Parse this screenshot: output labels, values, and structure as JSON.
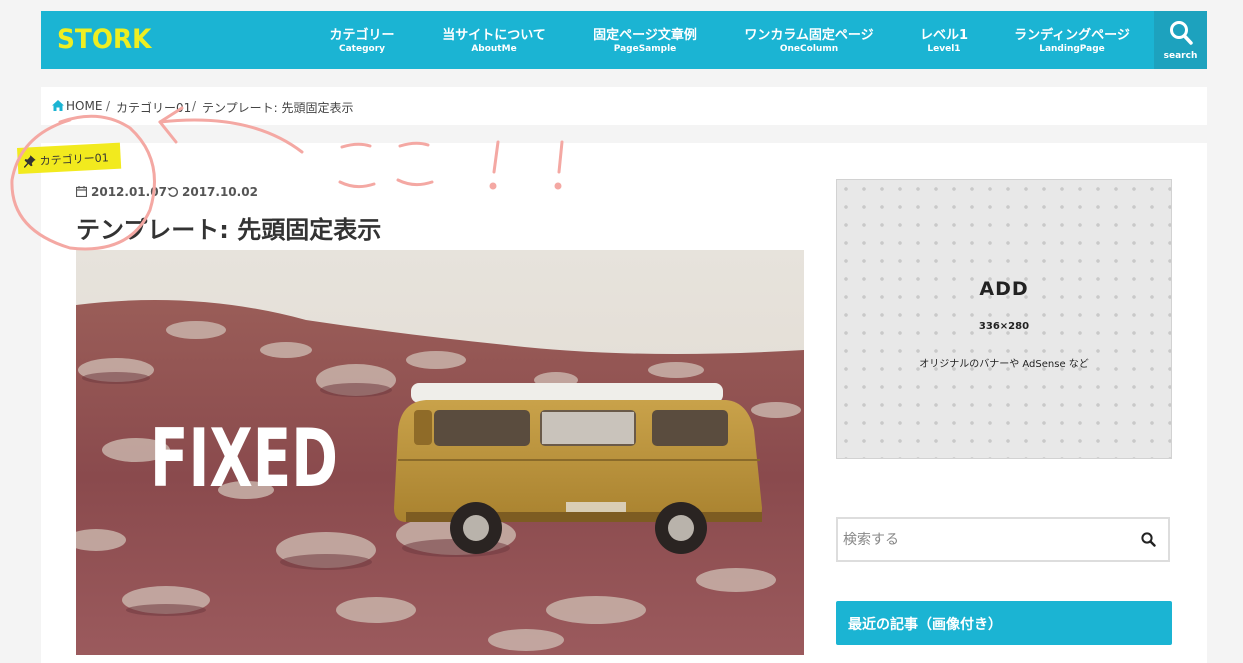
{
  "header": {
    "logo": "STORK",
    "nav": [
      {
        "ja": "カテゴリー",
        "en": "Category"
      },
      {
        "ja": "当サイトについて",
        "en": "AboutMe"
      },
      {
        "ja": "固定ページ文章例",
        "en": "PageSample"
      },
      {
        "ja": "ワンカラム固定ページ",
        "en": "OneColumn"
      },
      {
        "ja": "レベル1",
        "en": "Level1"
      },
      {
        "ja": "ランディングページ",
        "en": "LandingPage"
      }
    ],
    "search_label": "search",
    "search_icon": "search-icon"
  },
  "breadcrumb": {
    "home": "HOME",
    "category": "カテゴリー01",
    "current": "テンプレート: 先頭固定表示",
    "separator": "/",
    "home_icon": "home-icon"
  },
  "post": {
    "category": "カテゴリー01",
    "published": "2012.01.07",
    "updated": "2017.10.02",
    "title": "テンプレート: 先頭固定表示",
    "eyecatch_text": "FIXED"
  },
  "sidebar": {
    "ad": {
      "heading": "ADD",
      "size": "336×280",
      "description": "オリジナルのバナーや AdSense など"
    },
    "search_placeholder": "検索する",
    "recent_title": "最近の記事（画像付き）"
  },
  "annotation": {
    "text": "ここ！！"
  },
  "colors": {
    "accent": "#1bb4d3",
    "logo": "#eeee22",
    "badge": "#f2ea1e",
    "annotation": "#f4a8a3"
  }
}
